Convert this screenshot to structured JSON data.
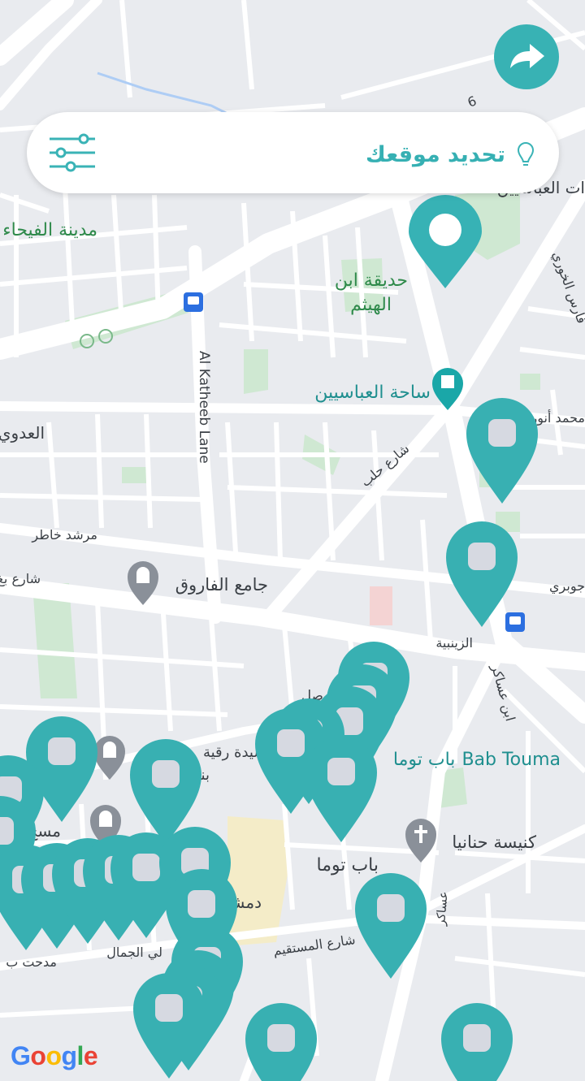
{
  "header": {
    "locate_label": "تحديد موقعك",
    "filter_icon": "sliders-icon",
    "location_icon": "lightbulb-pin-icon"
  },
  "navigate_icon": "turn-arrow-icon",
  "colors": {
    "accent": "#38b2b4",
    "map_bg": "#e9ebef",
    "road": "#ffffff",
    "park": "#c9e6cc",
    "label_green": "#2f8a4b",
    "label_teal": "#1f8f8f"
  },
  "map": {
    "labels": {
      "fayhaa": "مدينة الفيحاء",
      "ibn_haytham_1": "حديقة ابن",
      "ibn_haytham_2": "الهيثم",
      "abbasiyeen": "ساحة العباسيين",
      "katheeb": "Al Katheeb Lane",
      "adawi": "العدوي",
      "aleppo_st": "شارع حلب",
      "murshed": "مرشد خاطر",
      "baghdad": "شارع بغ",
      "farouq": "جامع الفاروق",
      "zaynabiya": "الزينبية",
      "ibn_asaker": "ابن عساكر",
      "bab_touma_en": "Bab Touma",
      "bab_touma_ar": "باب توما",
      "hananiya": "كنيسة حنانيا",
      "bab_touma_2": "باب توما",
      "mustaqeem": "شارع المستقيم",
      "damascus": "دمشق",
      "madhat": "مدحت ب",
      "jamal": "لي الجمال",
      "masjid": "مسج",
      "sayyida": "مقام السيدة رقية",
      "bint": "بنت",
      "mohammad_anwar": "محمد أنور",
      "jawbari": "جوبري",
      "faris": "فارس الخوري",
      "abbasiyeen_top": "ات العباسيين",
      "asaker2": "عساكر",
      "road6": "6",
      "saliba": "صل"
    },
    "icons": [
      "bus-stop-icon",
      "bus-stop-icon",
      "castle-icon",
      "mosque-icon",
      "mosque-icon",
      "mosque-icon",
      "church-icon",
      "cycling-icon"
    ],
    "current_location_marker": "location-pin-icon",
    "markers_label": "place-marker-icon"
  },
  "attribution": "Google"
}
